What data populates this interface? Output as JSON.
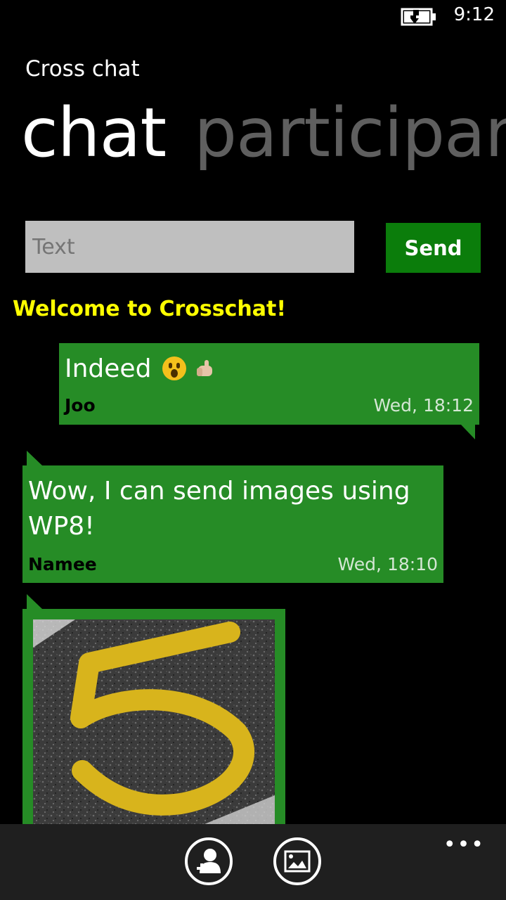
{
  "status": {
    "time": "9:12",
    "battery_icon": "battery-charging-icon"
  },
  "app": {
    "title": "Cross chat"
  },
  "pivot": {
    "active": "chat",
    "inactive": "participan"
  },
  "compose": {
    "placeholder": "Text",
    "value": "",
    "send_label": "Send"
  },
  "welcome": "Welcome to Crosschat!",
  "messages": [
    {
      "text": "Indeed",
      "emoji": [
        "astonished-face-icon",
        "thumbs-up-icon"
      ],
      "sender": "Joo",
      "time": "Wed, 18:12",
      "direction": "outgoing"
    },
    {
      "text": "Wow, I can send images using WP8!",
      "sender": "Namee",
      "time": "Wed, 18:10",
      "direction": "incoming"
    },
    {
      "image": "road-number-5-photo",
      "direction": "incoming"
    }
  ],
  "app_bar": {
    "buttons": [
      "add-participant-icon",
      "send-image-icon"
    ],
    "more": "•••"
  },
  "colors": {
    "background": "#000000",
    "bubble": "#268c26",
    "accent_green": "#0b7d0b",
    "welcome_yellow": "#ffff00",
    "pivot_inactive": "#5f5f5f",
    "app_bar": "#1f1f1f"
  }
}
